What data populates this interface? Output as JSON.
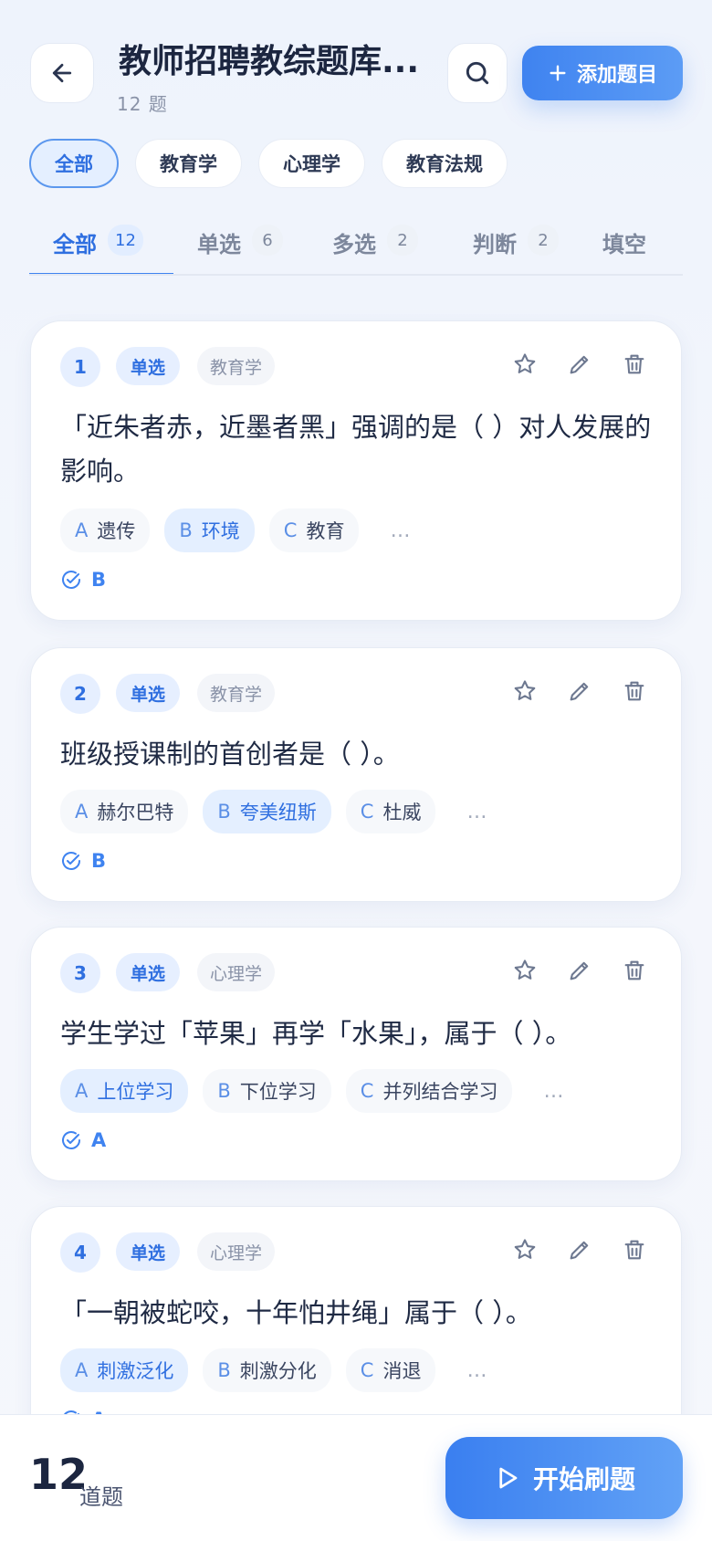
{
  "header": {
    "title": "教师招聘教综题库...",
    "subtitle": "12 题",
    "add_label": "添加题目"
  },
  "categories": [
    "全部",
    "教育学",
    "心理学",
    "教育法规"
  ],
  "tabs": [
    {
      "label": "全部",
      "count": "12"
    },
    {
      "label": "单选",
      "count": "6"
    },
    {
      "label": "多选",
      "count": "2"
    },
    {
      "label": "判断",
      "count": "2"
    },
    {
      "label": "填空",
      "count": ""
    }
  ],
  "questions": [
    {
      "num": "1",
      "type": "单选",
      "subject": "教育学",
      "text": "「近朱者赤，近墨者黑」强调的是（ ）对人发展的影响。",
      "options": [
        {
          "key": "A",
          "text": "遗传"
        },
        {
          "key": "B",
          "text": "环境"
        },
        {
          "key": "C",
          "text": "教育"
        }
      ],
      "more": "…",
      "answer": "B"
    },
    {
      "num": "2",
      "type": "单选",
      "subject": "教育学",
      "text": "班级授课制的首创者是（ ）。",
      "options": [
        {
          "key": "A",
          "text": "赫尔巴特"
        },
        {
          "key": "B",
          "text": "夸美纽斯"
        },
        {
          "key": "C",
          "text": "杜威"
        }
      ],
      "more": "…",
      "answer": "B"
    },
    {
      "num": "3",
      "type": "单选",
      "subject": "心理学",
      "text": "学生学过「苹果」再学「水果」，属于（ ）。",
      "options": [
        {
          "key": "A",
          "text": "上位学习"
        },
        {
          "key": "B",
          "text": "下位学习"
        },
        {
          "key": "C",
          "text": "并列结合学习"
        }
      ],
      "more": "…",
      "answer": "A"
    },
    {
      "num": "4",
      "type": "单选",
      "subject": "心理学",
      "text": "「一朝被蛇咬，十年怕井绳」属于（ ）。",
      "options": [
        {
          "key": "A",
          "text": "刺激泛化"
        },
        {
          "key": "B",
          "text": "刺激分化"
        },
        {
          "key": "C",
          "text": "消退"
        }
      ],
      "more": "…",
      "answer": "A"
    }
  ],
  "footer": {
    "total": "12",
    "total_label": "道题",
    "start_label": "开始刷题"
  },
  "colors": {
    "accent": "#3f83f0",
    "text": "#1f2a44"
  }
}
